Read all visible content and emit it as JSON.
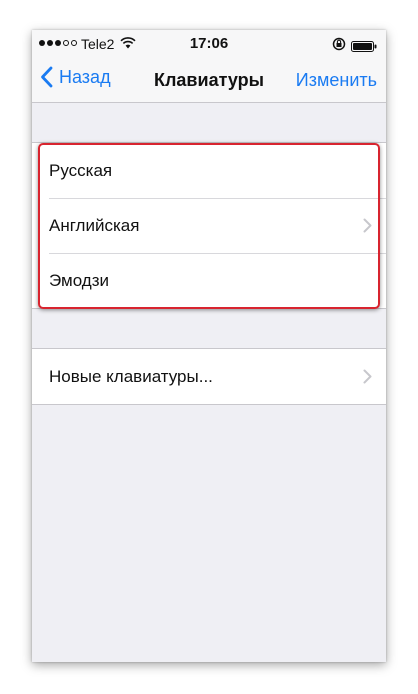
{
  "status_bar": {
    "carrier": "Tele2",
    "time": "17:06"
  },
  "nav": {
    "back_label": "Назад",
    "title": "Клавиатуры",
    "edit_label": "Изменить"
  },
  "keyboards": [
    {
      "label": "Русская",
      "has_chevron": false
    },
    {
      "label": "Английская",
      "has_chevron": true
    },
    {
      "label": "Эмодзи",
      "has_chevron": false
    }
  ],
  "new_keyboards": {
    "label": "Новые клавиатуры..."
  },
  "colors": {
    "accent": "#1a7bf2",
    "highlight": "#d8242f",
    "background": "#efeff4"
  }
}
